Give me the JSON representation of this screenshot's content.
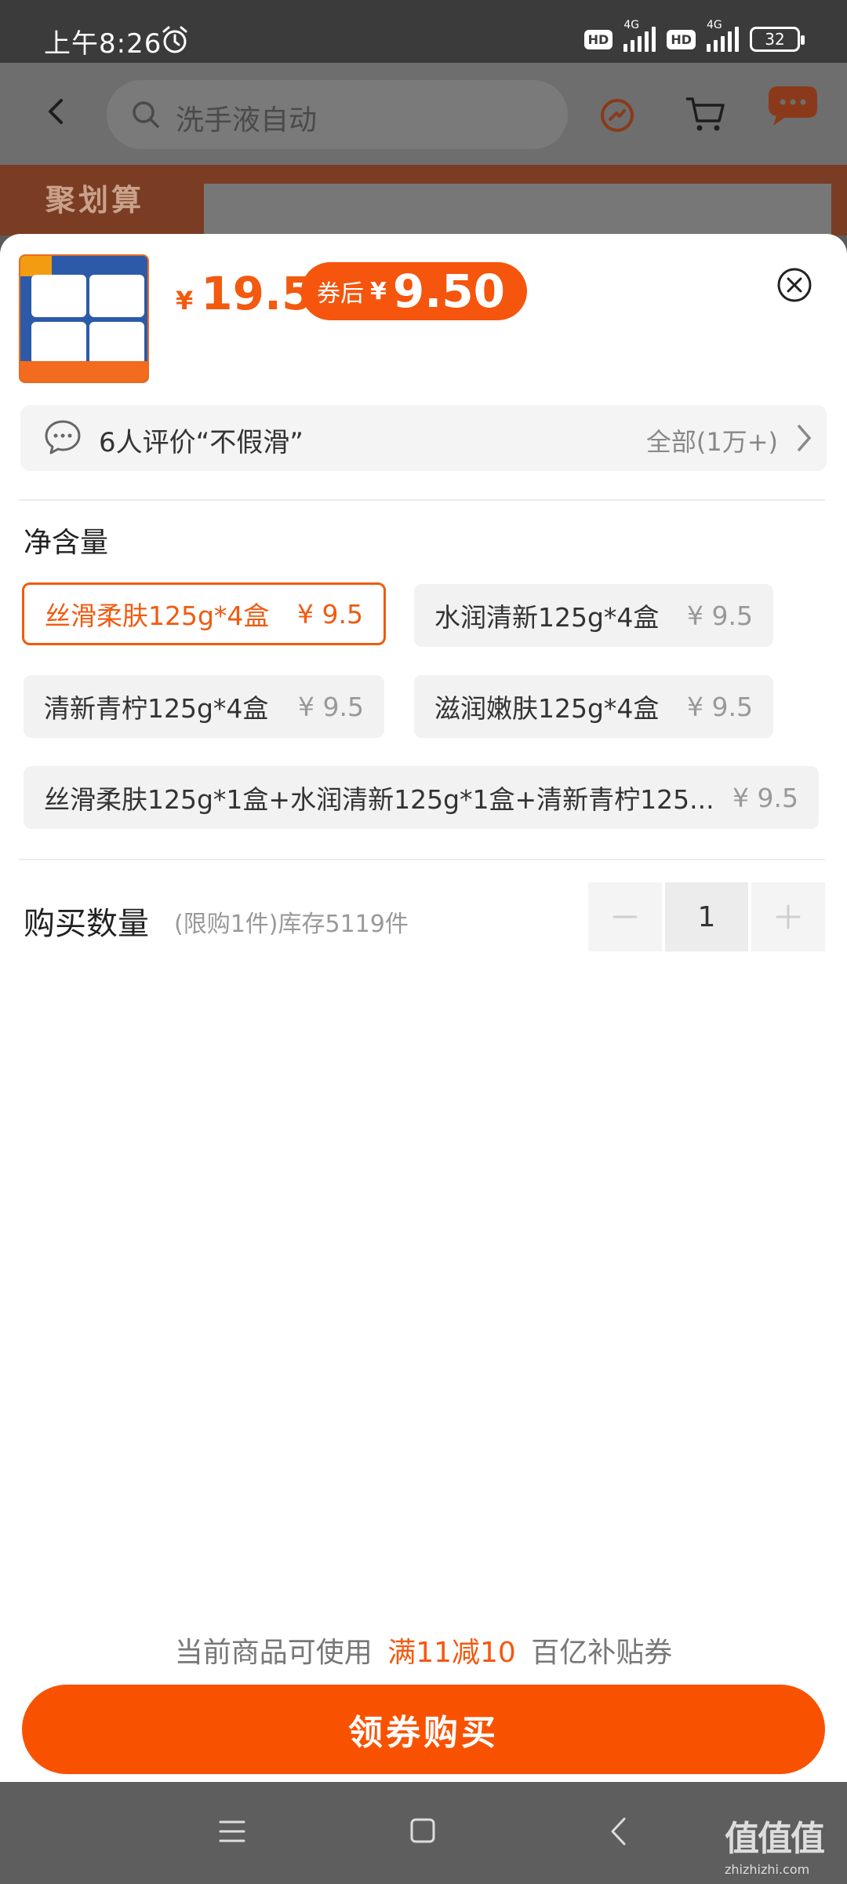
{
  "status_bar": {
    "time": "上午8:26",
    "hd1": "HD",
    "net1": "4G",
    "hd2": "HD",
    "net2": "4G",
    "battery": "32"
  },
  "header": {
    "search_text": "洗手液自动"
  },
  "banner": {
    "text": "聚划算"
  },
  "product": {
    "price_currency": "¥",
    "price": "19.5",
    "coupon_label": "券后",
    "coupon_currency": "¥",
    "coupon_price": "9.50"
  },
  "review": {
    "text": "6人评价“不假滑”",
    "all": "全部(1万+)"
  },
  "spec": {
    "title": "净含量",
    "options": [
      {
        "label": "丝滑柔肤125g*4盒",
        "price": "¥ 9.5"
      },
      {
        "label": "水润清新125g*4盒",
        "price": "¥ 9.5"
      },
      {
        "label": "清新青柠125g*4盒",
        "price": "¥ 9.5"
      },
      {
        "label": "滋润嫩肤125g*4盒",
        "price": "¥ 9.5"
      },
      {
        "label": "丝滑柔肤125g*1盒+水润清新125g*1盒+清新青柠125...",
        "price": "¥ 9.5"
      }
    ],
    "selected_index": 0
  },
  "quantity": {
    "label": "购买数量",
    "note": "(限购1件)库存5119件",
    "value": "1",
    "minus": "−",
    "plus": "+"
  },
  "footer": {
    "note_prefix": "当前商品可使用",
    "note_highlight": "满11减10",
    "note_suffix": "百亿补贴券",
    "buy_label": "领券购买"
  },
  "watermark": {
    "big": "值值值",
    "small": "zhizhizhi.com"
  },
  "colors": {
    "accent": "#f25a10",
    "button": "#f85200"
  }
}
